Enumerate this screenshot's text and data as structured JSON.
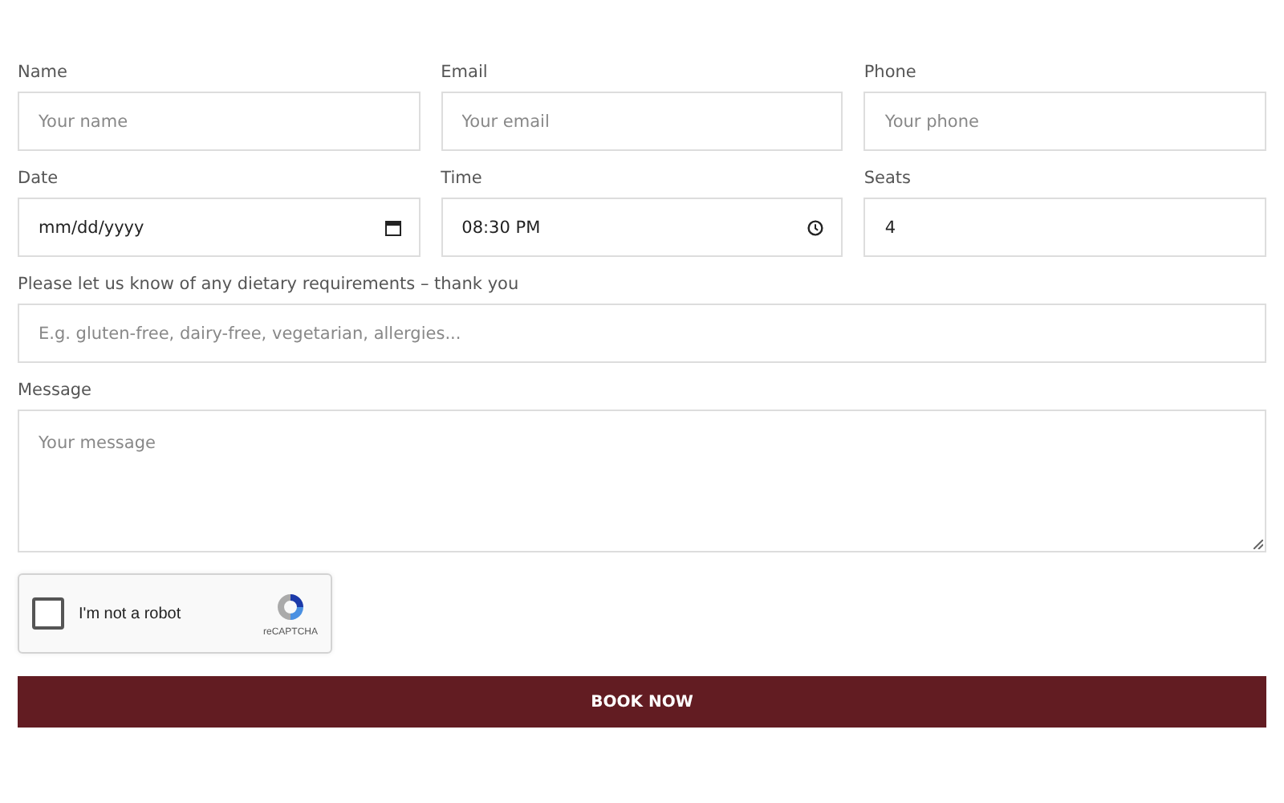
{
  "rows": [
    {
      "fields": [
        {
          "kind": "text",
          "label": "Name",
          "placeholder": "Your name"
        },
        {
          "kind": "text",
          "label": "Email",
          "placeholder": "Your email"
        },
        {
          "kind": "text",
          "label": "Phone",
          "placeholder": "Your phone"
        }
      ]
    },
    {
      "fields": [
        {
          "kind": "date",
          "label": "Date",
          "value": "mm/dd/yyyy"
        },
        {
          "kind": "time",
          "label": "Time",
          "value": "08:30 PM"
        },
        {
          "kind": "number",
          "label": "Seats",
          "value": "4"
        }
      ]
    },
    {
      "fields": [
        {
          "kind": "text",
          "label": "Please let us know of any dietary requirements – thank you",
          "placeholder": "E.g. gluten-free, dairy-free, vegetarian, allergies..."
        }
      ]
    },
    {
      "fields": [
        {
          "kind": "textarea",
          "label": "Message",
          "placeholder": "Your message"
        }
      ]
    }
  ],
  "captcha": {
    "label": "I'm not a robot",
    "checked": false,
    "brand": "reCAPTCHA"
  },
  "submit": {
    "label": "BOOK NOW"
  }
}
